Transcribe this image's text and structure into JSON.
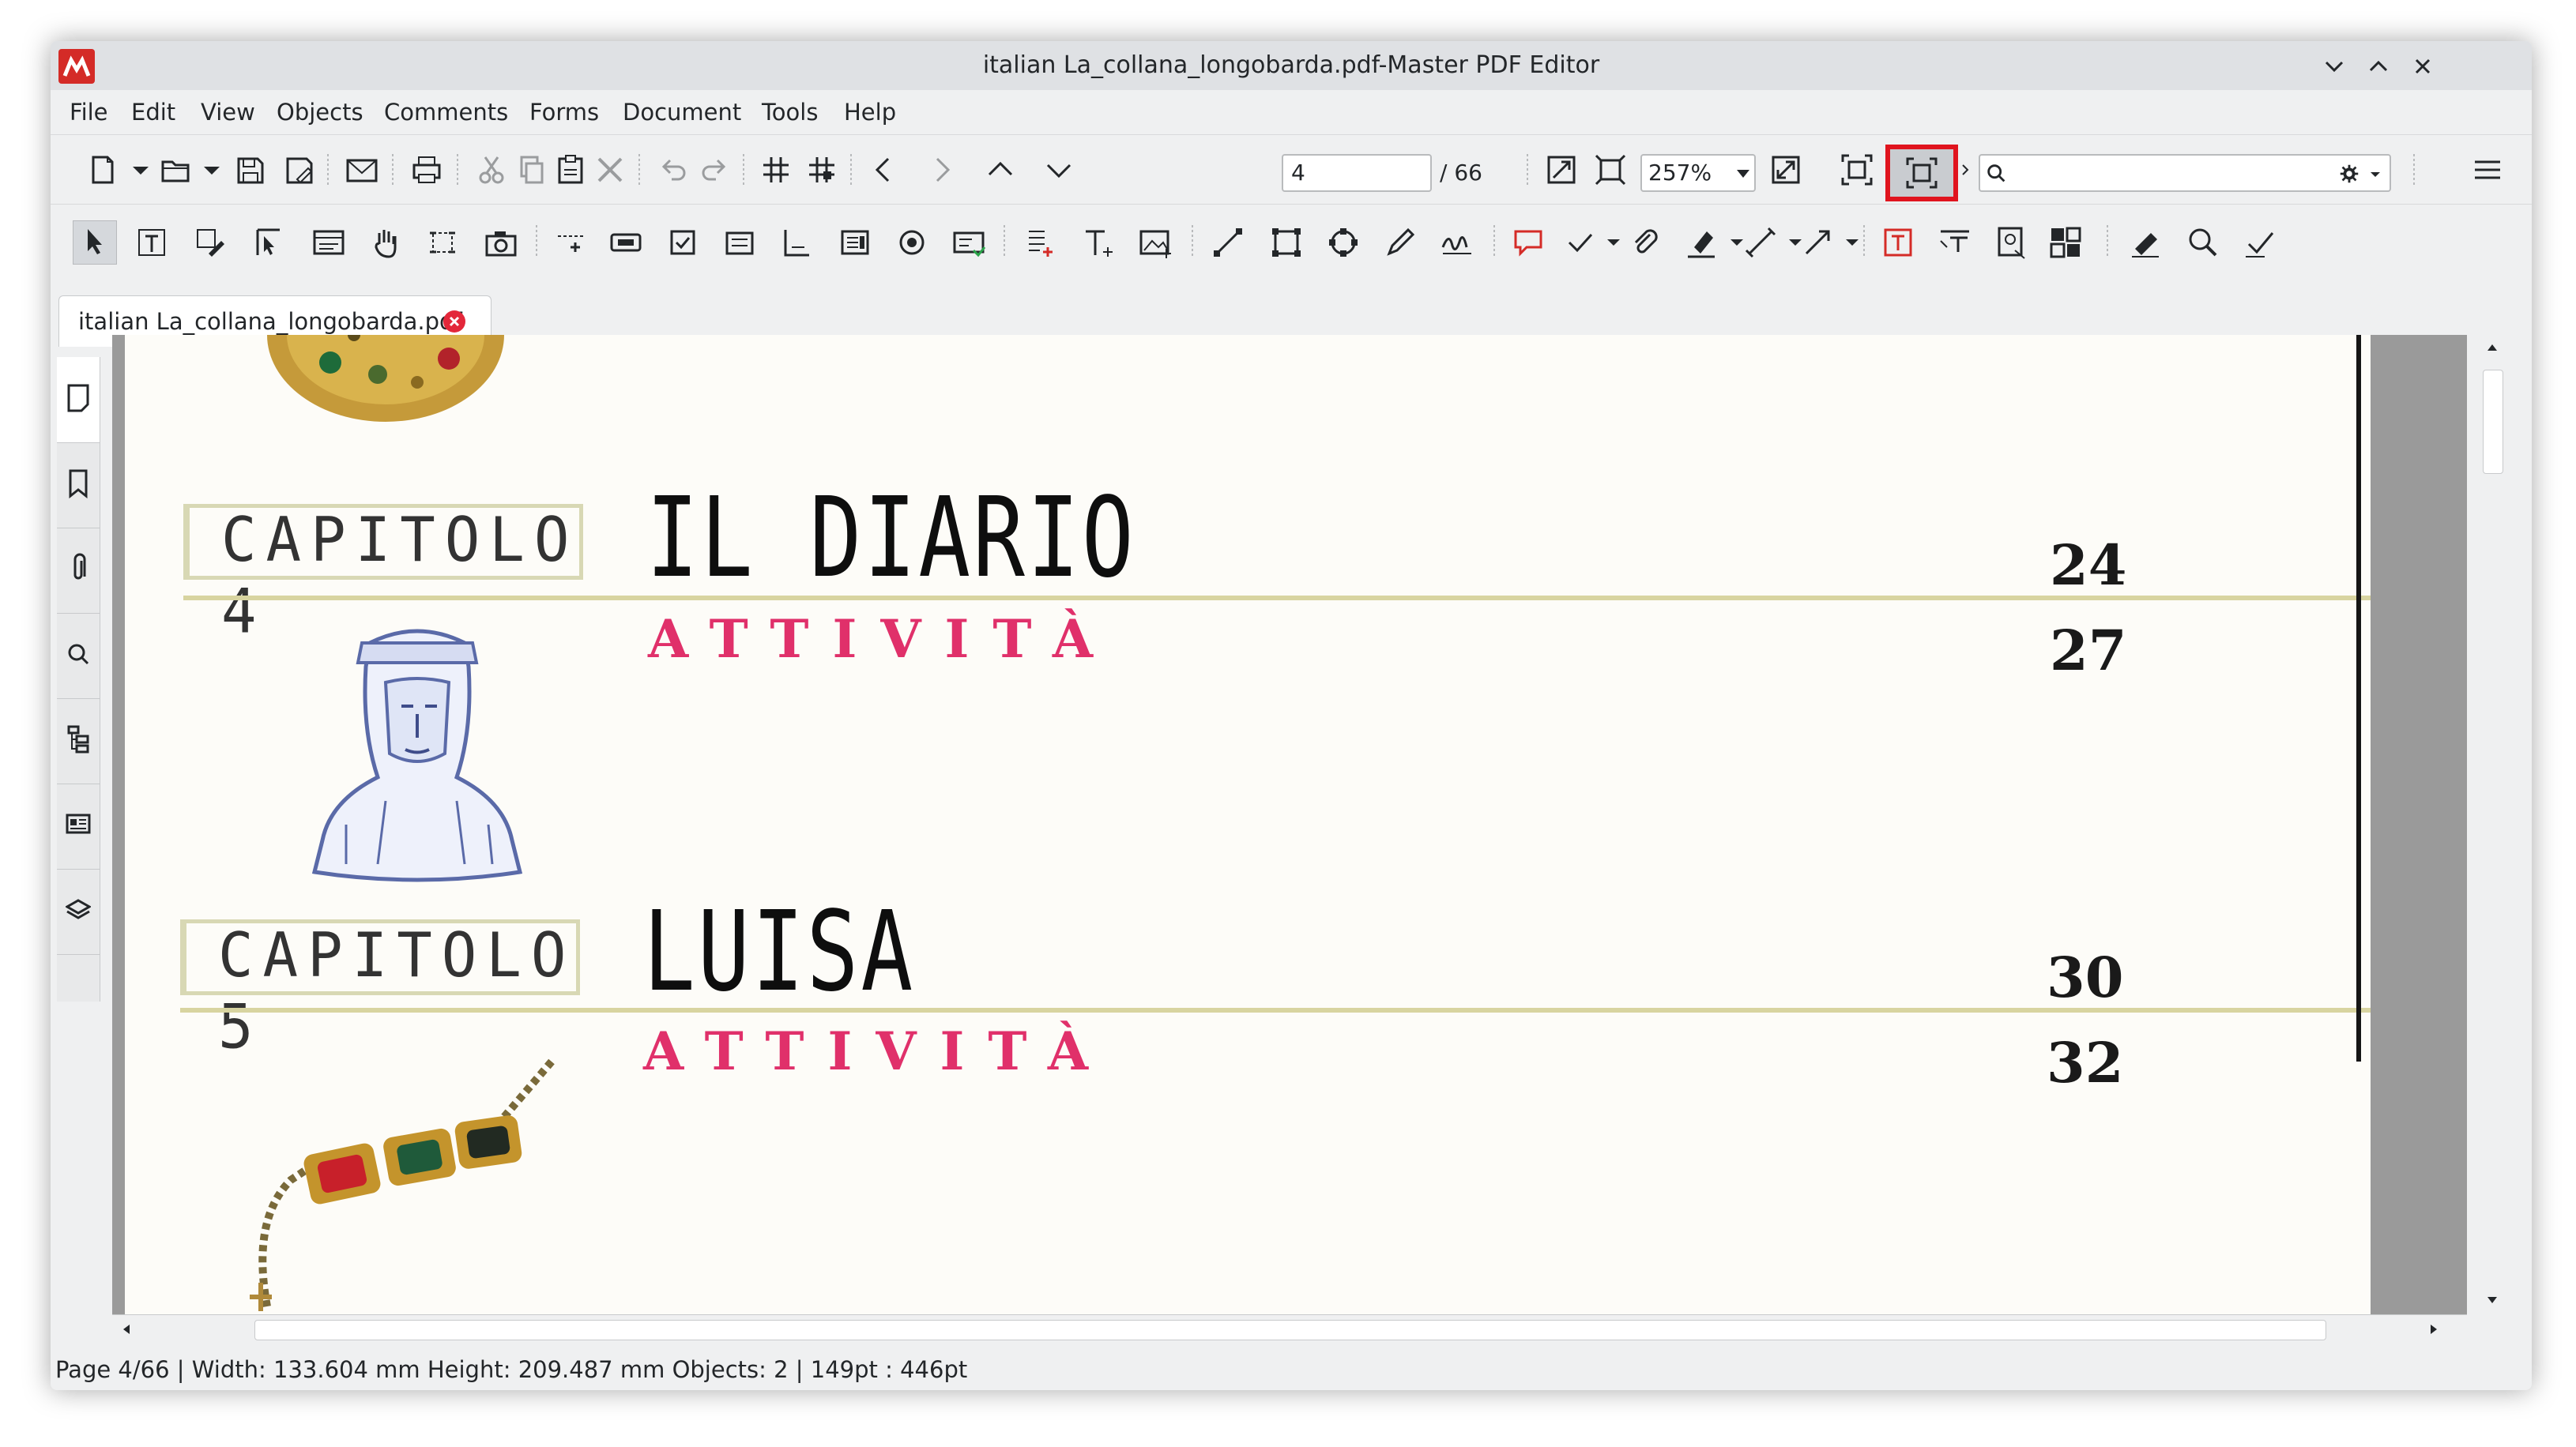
{
  "window": {
    "title": "italian La_collana_longobarda.pdf-Master PDF Editor"
  },
  "menu": [
    "File",
    "Edit",
    "View",
    "Objects",
    "Comments",
    "Forms",
    "Document",
    "Tools",
    "Help"
  ],
  "toolbar": {
    "page_input": "4",
    "page_total": "/ 66",
    "zoom": "257%",
    "search_placeholder": ""
  },
  "tab": {
    "label": "italian La_collana_longobarda.pdf"
  },
  "document": {
    "chapters": [
      {
        "label": "CAPITOLO 4",
        "title": "IL DIARIO",
        "activity": "ATTIVITÀ",
        "page": "24",
        "activity_page": "27"
      },
      {
        "label": "CAPITOLO 5",
        "title": "LUISA",
        "activity": "ATTIVITÀ",
        "page": "30",
        "activity_page": "32"
      }
    ]
  },
  "status": {
    "text": "Page 4/66 | Width: 133.604 mm Height: 209.487 mm Objects: 2  |   149pt : 446pt"
  },
  "colors": {
    "accent_red": "#e0141e",
    "attivita_pink": "#e0306a"
  }
}
